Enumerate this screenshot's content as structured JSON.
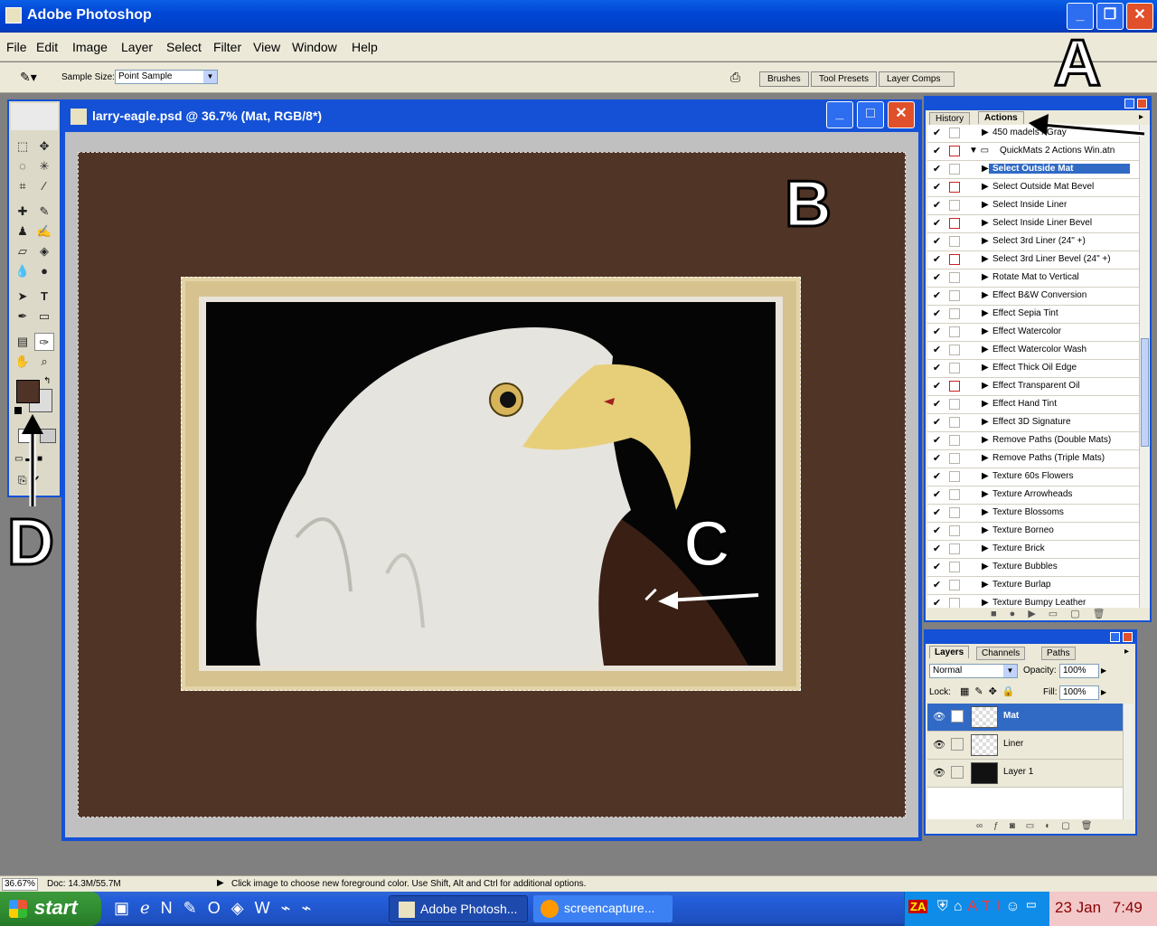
{
  "title": "Adobe Photoshop",
  "menu": [
    "File",
    "Edit",
    "Image",
    "Layer",
    "Select",
    "Filter",
    "View",
    "Window",
    "Help"
  ],
  "options": {
    "sample_size_label": "Sample Size:",
    "sample_size_value": "Point Sample"
  },
  "palette_well": [
    "Brushes",
    "Tool Presets",
    "Layer Comps"
  ],
  "document": {
    "title": "larry-eagle.psd @ 36.7% (Mat, RGB/8*)"
  },
  "actions_panel": {
    "tabs": [
      "History",
      "Actions"
    ],
    "rows": [
      {
        "label": "450 madels / Gray",
        "chk": true,
        "dlg": false,
        "type": "item"
      },
      {
        "label": "QuickMats 2 Actions Win.atn",
        "chk": true,
        "dlg": true,
        "type": "set"
      },
      {
        "label": "Select Outside Mat",
        "chk": true,
        "dlg": false,
        "type": "item",
        "selected": true
      },
      {
        "label": "Select Outside Mat Bevel",
        "chk": true,
        "dlg": true,
        "type": "item"
      },
      {
        "label": "Select Inside Liner",
        "chk": true,
        "dlg": false,
        "type": "item"
      },
      {
        "label": "Select Inside Liner Bevel",
        "chk": true,
        "dlg": true,
        "type": "item"
      },
      {
        "label": "Select 3rd Liner (24\" +)",
        "chk": true,
        "dlg": false,
        "type": "item"
      },
      {
        "label": "Select 3rd Liner Bevel (24\" +)",
        "chk": true,
        "dlg": true,
        "type": "item"
      },
      {
        "label": "Rotate Mat to Vertical",
        "chk": true,
        "dlg": false,
        "type": "item"
      },
      {
        "label": "Effect B&W Conversion",
        "chk": true,
        "dlg": false,
        "type": "item"
      },
      {
        "label": "Effect Sepia Tint",
        "chk": true,
        "dlg": false,
        "type": "item"
      },
      {
        "label": "Effect Watercolor",
        "chk": true,
        "dlg": false,
        "type": "item"
      },
      {
        "label": "Effect Watercolor Wash",
        "chk": true,
        "dlg": false,
        "type": "item"
      },
      {
        "label": "Effect Thick Oil Edge",
        "chk": true,
        "dlg": false,
        "type": "item"
      },
      {
        "label": "Effect Transparent Oil",
        "chk": true,
        "dlg": true,
        "type": "item"
      },
      {
        "label": "Effect Hand Tint",
        "chk": true,
        "dlg": false,
        "type": "item"
      },
      {
        "label": "Effect 3D Signature",
        "chk": true,
        "dlg": false,
        "type": "item"
      },
      {
        "label": "Remove Paths (Double Mats)",
        "chk": true,
        "dlg": false,
        "type": "item"
      },
      {
        "label": "Remove Paths (Triple Mats)",
        "chk": true,
        "dlg": false,
        "type": "item"
      },
      {
        "label": "Texture 60s Flowers",
        "chk": true,
        "dlg": false,
        "type": "item"
      },
      {
        "label": "Texture Arrowheads",
        "chk": true,
        "dlg": false,
        "type": "item"
      },
      {
        "label": "Texture Blossoms",
        "chk": true,
        "dlg": false,
        "type": "item"
      },
      {
        "label": "Texture Borneo",
        "chk": true,
        "dlg": false,
        "type": "item"
      },
      {
        "label": "Texture Brick",
        "chk": true,
        "dlg": false,
        "type": "item"
      },
      {
        "label": "Texture Bubbles",
        "chk": true,
        "dlg": false,
        "type": "item"
      },
      {
        "label": "Texture Burlap",
        "chk": true,
        "dlg": false,
        "type": "item"
      },
      {
        "label": "Texture Bumpy Leather",
        "chk": true,
        "dlg": false,
        "type": "item"
      }
    ]
  },
  "layers_panel": {
    "tabs": [
      "Layers",
      "Channels",
      "Paths"
    ],
    "blend_mode": "Normal",
    "opacity_label": "Opacity:",
    "opacity": "100%",
    "lock_label": "Lock:",
    "fill_label": "Fill:",
    "fill": "100%",
    "layers": [
      {
        "name": "Mat",
        "selected": true
      },
      {
        "name": "Liner",
        "selected": false
      },
      {
        "name": "Layer 1",
        "selected": false
      }
    ]
  },
  "status": {
    "zoom": "36.67%",
    "doc": "Doc: 14.3M/55.7M",
    "hint": "Click image to choose new foreground color.  Use Shift, Alt and Ctrl for additional options."
  },
  "taskbar": {
    "start": "start",
    "buttons": [
      "Adobe Photosh...",
      "screencapture..."
    ],
    "date": "23 Jan",
    "time": "7:49"
  },
  "annotations": [
    "A",
    "B",
    "C",
    "D"
  ],
  "colors": {
    "foreground": "#4e3326",
    "mat": "#503426",
    "liner": "#d6c28e",
    "selection": "#316ac5"
  }
}
